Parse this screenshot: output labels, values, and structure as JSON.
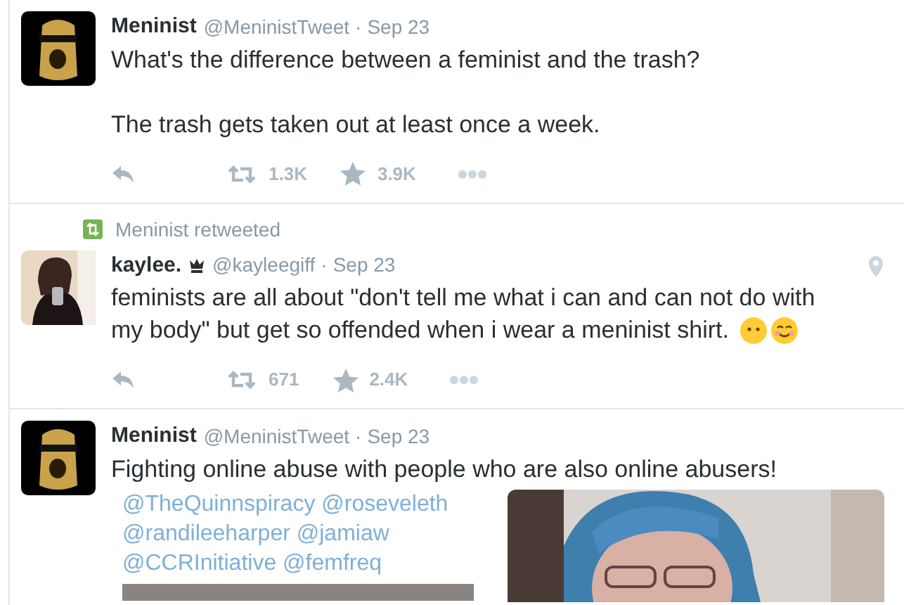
{
  "tweets": [
    {
      "avatar": {
        "kind": "logo"
      },
      "name": "Meninist",
      "badge": false,
      "handle": "@MeninistTweet",
      "separator": "·",
      "date": "Sep 23",
      "geo": false,
      "paragraphs": [
        [
          "What's the difference between a feminist and the trash?"
        ],
        [
          "The trash gets taken out at least once a week."
        ]
      ],
      "retweets": "1.3K",
      "likes": "3.9K"
    },
    {
      "retweeted_by": "Meninist retweeted",
      "avatar": {
        "kind": "person"
      },
      "name": "kaylee.",
      "badge": true,
      "handle": "@kayleegiff",
      "separator": "·",
      "date": "Sep 23",
      "geo": true,
      "paragraphs": [
        [
          "feminists are all about \"don't tell me what i can and can not do with",
          "my body\" but get so offended when i wear a meninist shirt."
        ]
      ],
      "emoji": [
        {
          "kind": "neutral"
        },
        {
          "kind": "smiling"
        }
      ],
      "retweets": "671",
      "likes": "2.4K"
    },
    {
      "avatar": {
        "kind": "logo"
      },
      "name": "Meninist",
      "badge": false,
      "handle": "@MeninistTweet",
      "separator": "·",
      "date": "Sep 23",
      "geo": false,
      "paragraphs": [
        [
          "Fighting online abuse with people who are also online abusers!"
        ]
      ],
      "media": {
        "mentions": [
          "@TheQuinnspiracy @roseveleth",
          "@randileeharper @jamiaw",
          "@CCRInitiative @femfreq"
        ]
      }
    }
  ]
}
